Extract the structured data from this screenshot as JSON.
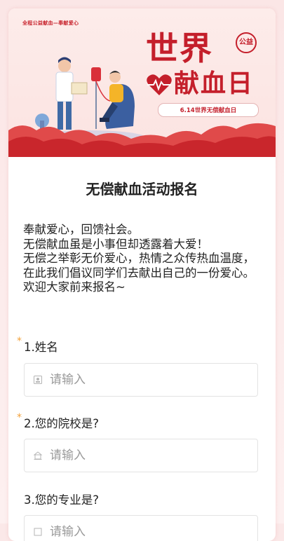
{
  "banner": {
    "caption": "全程公益献血—奉献爱心",
    "title_line1": "世界",
    "badge": "公益",
    "title_line2": "献血日",
    "date_text": "6.14世界无偿献血日"
  },
  "form": {
    "title": "无偿献血活动报名",
    "intro": [
      "奉献爱心，回馈社会。",
      "无偿献血虽是小事但却透露着大爱！",
      "无偿之举彰无价爱心，热情之众传热血温度，在此我们倡议同学们去献出自己的一份爱心。",
      "欢迎大家前来报名~"
    ],
    "questions": [
      {
        "label": "1.姓名",
        "required": "*",
        "placeholder": "请输入",
        "icon": "person-card-icon"
      },
      {
        "label": "2.您的院校是?",
        "required": "*",
        "placeholder": "请输入",
        "icon": "school-icon"
      },
      {
        "label": "3.您的专业是?",
        "required": "",
        "placeholder": "请输入",
        "icon": "book-icon"
      }
    ]
  },
  "colors": {
    "brand_red": "#c41f2b",
    "required_star": "#f3a13a",
    "page_bg": "#fbe8e8"
  }
}
